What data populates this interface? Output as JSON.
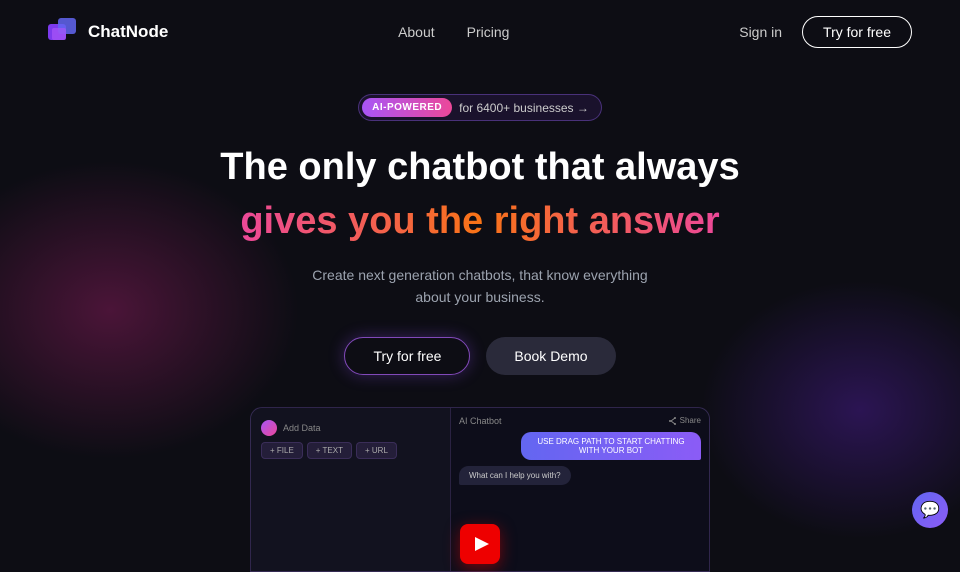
{
  "navbar": {
    "logo_text": "ChatNode",
    "nav_links": [
      {
        "label": "About",
        "id": "about"
      },
      {
        "label": "Pricing",
        "id": "pricing"
      }
    ],
    "signin_label": "Sign in",
    "try_free_label": "Try for free"
  },
  "hero": {
    "badge": {
      "label": "AI-POWERED",
      "text": "for 6400+ businesses →"
    },
    "headline_line1": "The only chatbot that always",
    "headline_line2": "gives you the right answer",
    "subheadline": "Create next generation chatbots, that know everything about your business.",
    "cta_primary": "Try for free",
    "cta_secondary": "Book Demo"
  },
  "dashboard": {
    "left_panel_title": "Add Data",
    "actions": [
      "+ FILE",
      "+ TEXT",
      "+ URL"
    ],
    "chat_title": "AI Chatbot",
    "share_label": "Share",
    "user_message": "USE DRAG PATH TO START CHATTING WITH YOUR BOT",
    "bot_message": "What can I help you with?"
  },
  "chat_widget": {
    "icon": "💬"
  },
  "play_button": {
    "label": "Play video"
  }
}
